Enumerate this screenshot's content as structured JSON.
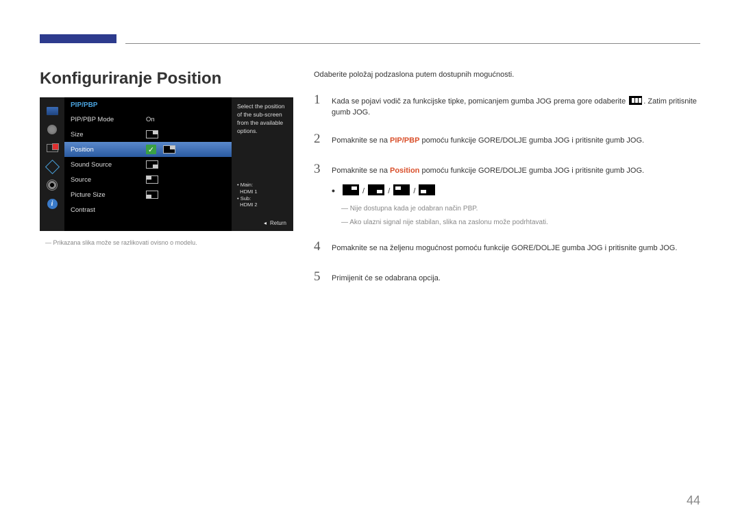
{
  "header": {
    "title": "Konfiguriranje Position",
    "page_number": "44"
  },
  "osd": {
    "title": "PIP/PBP",
    "hint": "Select the position of the sub-screen from the available options.",
    "rows": {
      "mode": {
        "label": "PIP/PBP Mode",
        "value": "On"
      },
      "size": {
        "label": "Size"
      },
      "position": {
        "label": "Position"
      },
      "soundsource": {
        "label": "Sound Source"
      },
      "source": {
        "label": "Source"
      },
      "picturesize": {
        "label": "Picture Size"
      },
      "contrast": {
        "label": "Contrast"
      }
    },
    "source_info": {
      "main_label": "Main:",
      "main_value": "HDMI 1",
      "sub_label": "Sub:",
      "sub_value": "HDMI 2"
    },
    "return_label": "Return"
  },
  "disclaimer": "Prikazana slika može se razlikovati ovisno o modelu.",
  "content": {
    "intro": "Odaberite položaj podzaslona putem dostupnih mogućnosti.",
    "step1_a": "Kada se pojavi vodič za funkcijske tipke, pomicanjem gumba JOG prema gore odaberite",
    "step1_b": ". Zatim pritisnite gumb JOG.",
    "step2_a": "Pomaknite se na ",
    "step2_hl": "PIP/PBP",
    "step2_b": " pomoću funkcije GORE/DOLJE gumba JOG i pritisnite gumb JOG.",
    "step3_a": "Pomaknite se na ",
    "step3_hl": "Position",
    "step3_b": " pomoću funkcije GORE/DOLJE gumba JOG i pritisnite gumb JOG.",
    "note1": "Nije dostupna kada je odabran način PBP.",
    "note2": "Ako ulazni signal nije stabilan, slika na zaslonu može podrhtavati.",
    "step4": "Pomaknite se na željenu mogućnost pomoću funkcije GORE/DOLJE gumba JOG i pritisnite gumb JOG.",
    "step5": "Primijenit će se odabrana opcija."
  },
  "info_glyph": "i"
}
